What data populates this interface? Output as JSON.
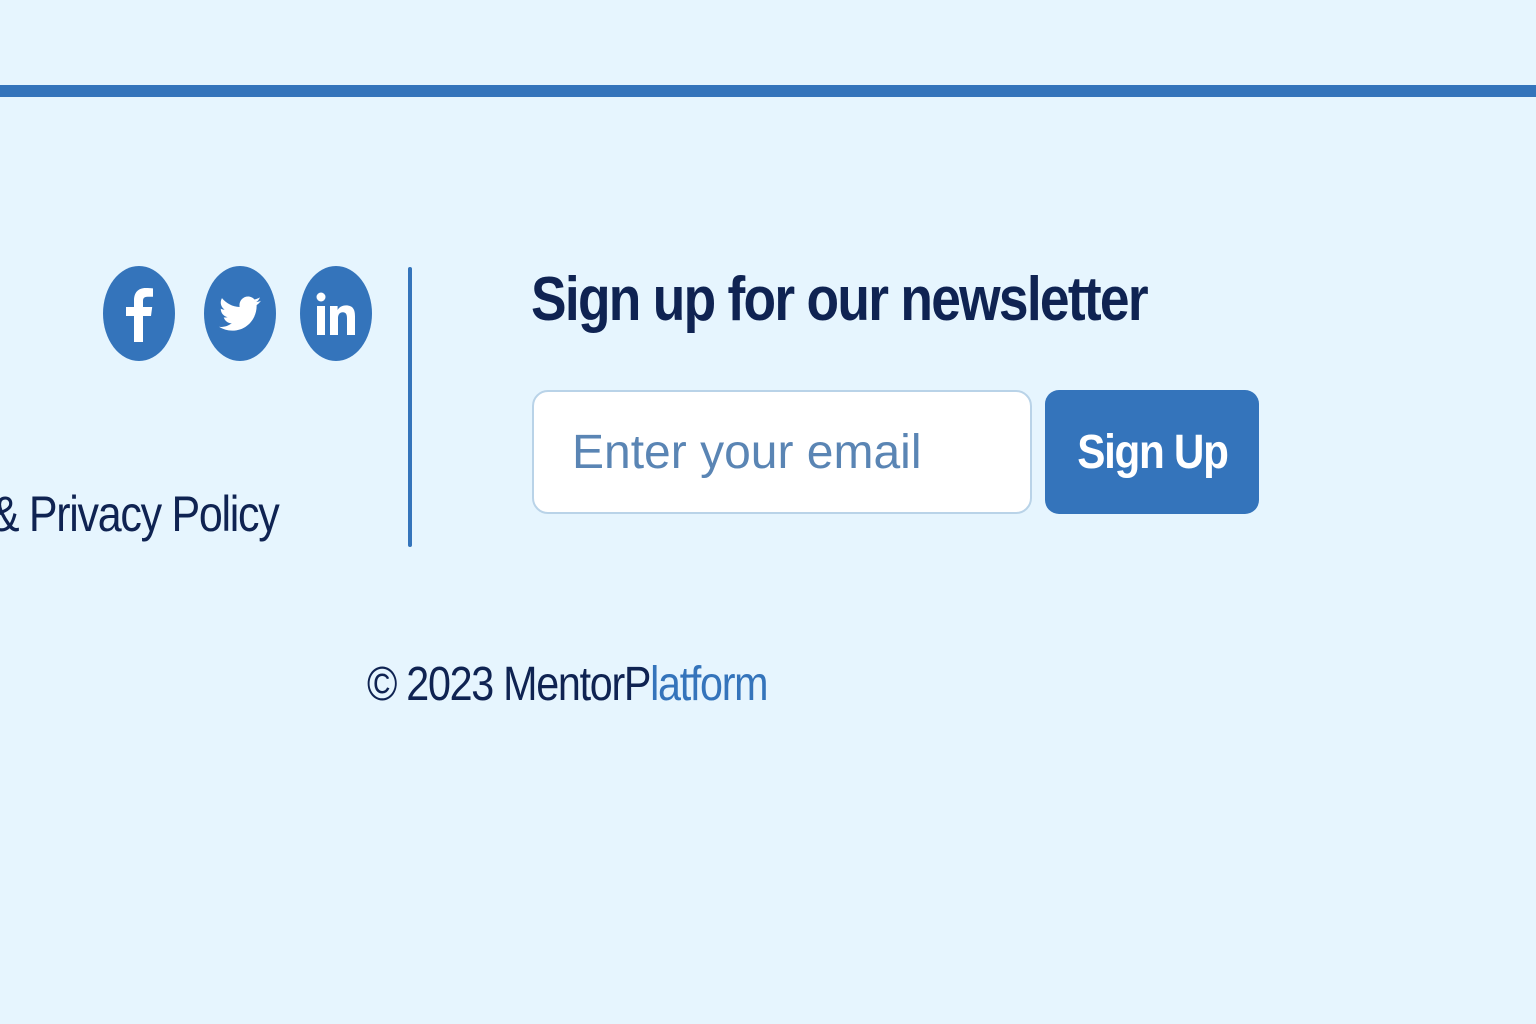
{
  "footer": {
    "social": [
      {
        "name": "facebook",
        "icon": "facebook-icon"
      },
      {
        "name": "twitter",
        "icon": "twitter-icon"
      },
      {
        "name": "linkedin",
        "icon": "linkedin-icon"
      }
    ],
    "legal_link": "& Privacy Policy",
    "copyright": {
      "prefix": "© 2023 ",
      "brand_start": "MentorP",
      "brand_end": "latform"
    }
  },
  "newsletter": {
    "title": "Sign up for our newsletter",
    "email_placeholder": "Enter your email",
    "email_value": "",
    "button_label": "Sign Up"
  },
  "colors": {
    "background": "#e6f5fe",
    "accent": "#3474bb",
    "text_dark": "#0f2352",
    "placeholder": "#5a85b4"
  }
}
